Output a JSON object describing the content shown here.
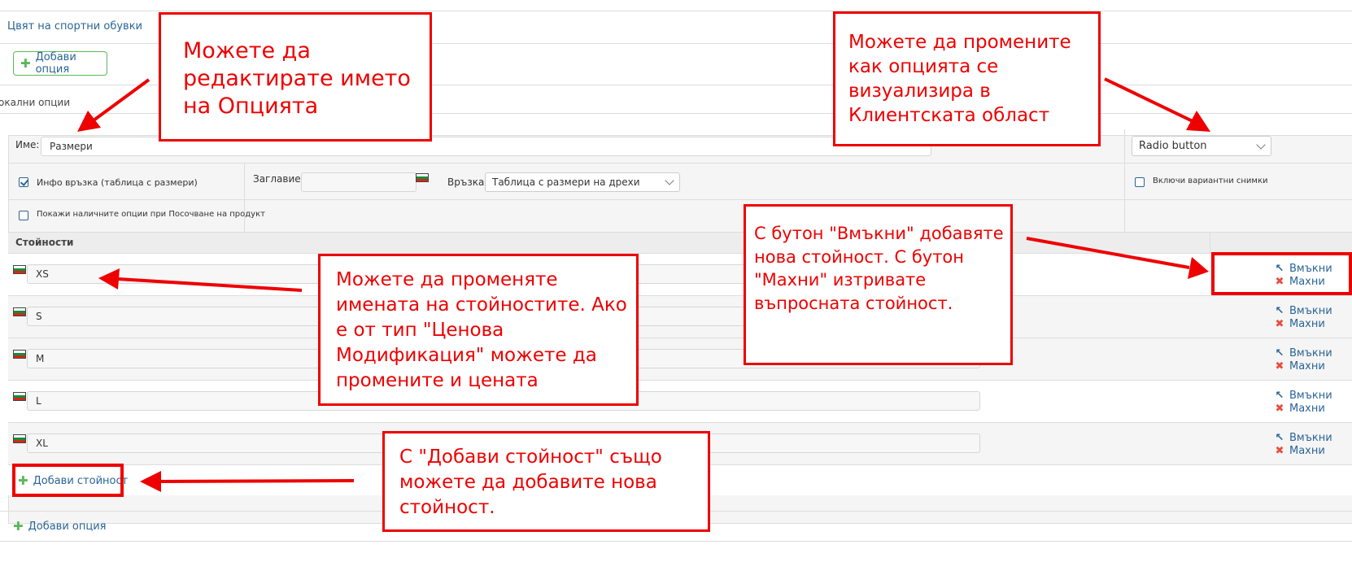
{
  "breadcrumb_link": "Цвят на спортни обувки",
  "add_option_label": "Добави опция",
  "local_options_label": "окални опции",
  "name_label": "Име:",
  "name_value": "Размери",
  "display_type_value": "Radio button",
  "info_link_label": "Инфо връзка (таблица с размери)",
  "title_label": "Заглавие:",
  "title_value": "",
  "link_label": "Връзка:",
  "link_value": "Таблица с размери на дрехи",
  "variant_images_label": "Включи вариантни снимки",
  "show_available_label": "Покажи наличните опции при Посочване на продукт",
  "values_header": "Стойности",
  "values": [
    {
      "name": "XS"
    },
    {
      "name": "S"
    },
    {
      "name": "M"
    },
    {
      "name": "L"
    },
    {
      "name": "XL"
    }
  ],
  "insert_label": "Вмъкни",
  "remove_label": "Махни",
  "add_value_label": "Добави стойност",
  "add_option_bottom_label": "Добави опция",
  "callouts": {
    "edit_name": "Можете да редактирате името на Опцията",
    "display_type": "Можете да промените как опцията се визуализира в Клиентската област",
    "insert_remove": "С бутон \"Вмъкни\" добавяте нова стойност. С бутон \"Махни\" изтривате въпросната стойност.",
    "value_names": "Можете да променяте имената на стойностите. Ако е от тип \"Ценова Модификация\" можете да промените и цената",
    "add_value": "С \"Добави стойност\" също можете да добавите нова стойност."
  },
  "colors": {
    "annotation": "#e00000",
    "link": "#2a6496",
    "success": "#5cb85c"
  }
}
